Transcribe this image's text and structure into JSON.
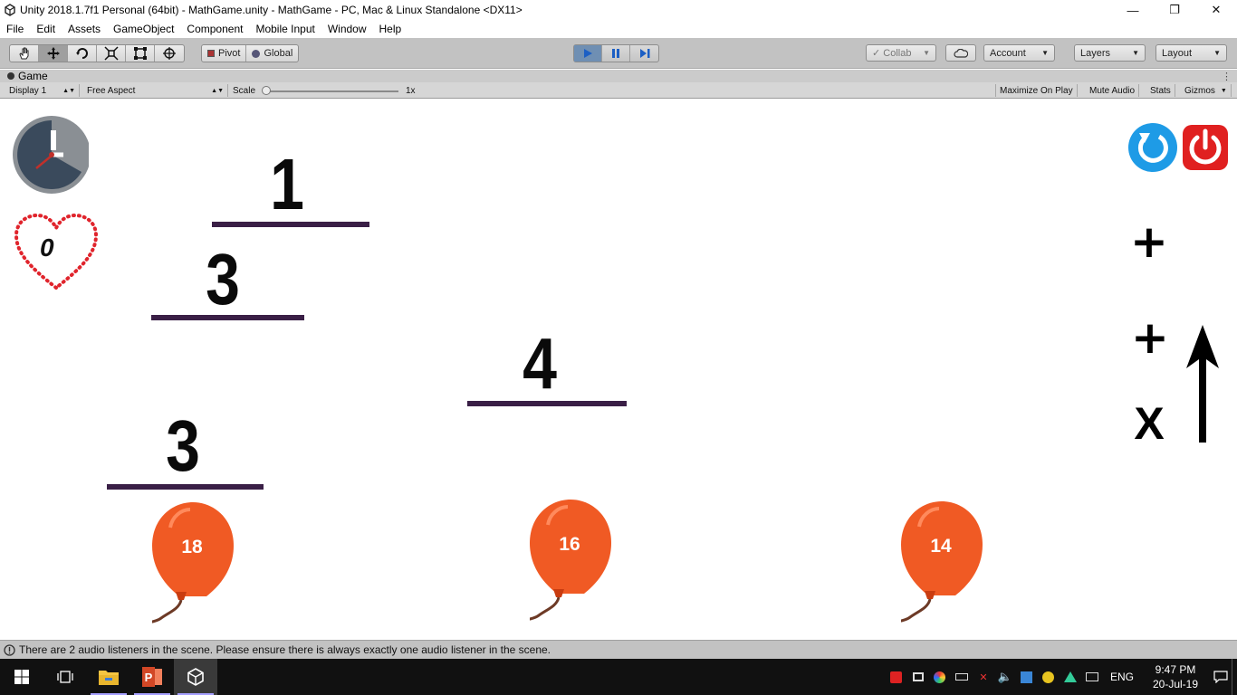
{
  "window": {
    "title": "Unity 2018.1.7f1 Personal (64bit) - MathGame.unity - MathGame - PC, Mac & Linux Standalone <DX11>",
    "minimize": "—",
    "maximize": "❐",
    "close": "✕"
  },
  "menu": [
    "File",
    "Edit",
    "Assets",
    "GameObject",
    "Component",
    "Mobile Input",
    "Window",
    "Help"
  ],
  "toolbar": {
    "pivot": "Pivot",
    "global": "Global",
    "collab": "Collab",
    "account": "Account",
    "layers": "Layers",
    "layout": "Layout"
  },
  "game_tab": {
    "title": "Game",
    "display": "Display 1",
    "aspect": "Free Aspect",
    "scale_label": "Scale",
    "scale_value": "1x",
    "maximize_on_play": "Maximize On Play",
    "mute_audio": "Mute Audio",
    "stats": "Stats",
    "gizmos": "Gizmos"
  },
  "game": {
    "lives": "0",
    "numbers": [
      "1",
      "3",
      "4",
      "3"
    ],
    "operators": [
      "+",
      "+",
      "X"
    ],
    "balloons": [
      "18",
      "16",
      "14"
    ],
    "colors": {
      "balloon": "#f05a24",
      "line": "#3a1f46",
      "timer": "#3a4a5c",
      "restart": "#1e9be6",
      "power": "#e02020"
    }
  },
  "status": {
    "message": "There are 2 audio listeners in the scene. Please ensure there is always exactly one audio listener in the scene."
  },
  "taskbar": {
    "language": "ENG",
    "time": "9:47 PM",
    "date": "20-Jul-19"
  }
}
